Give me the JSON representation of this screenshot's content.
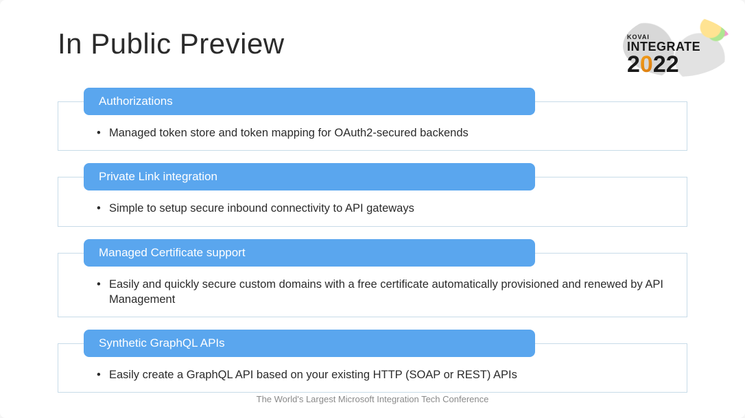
{
  "title": "In Public Preview",
  "logo": {
    "brand": "KOVAI",
    "word": "INTEGRATE",
    "year_prefix": "2",
    "year_zero": "0",
    "year_suffix": "22"
  },
  "items": [
    {
      "header": "Authorizations",
      "bullet": "Managed token store and token mapping for OAuth2-secured backends"
    },
    {
      "header": "Private Link integration",
      "bullet": "Simple to setup secure inbound connectivity to API gateways"
    },
    {
      "header": "Managed Certificate support",
      "bullet": "Easily and quickly secure custom domains with a free certificate automatically provisioned and renewed by API Management"
    },
    {
      "header": "Synthetic GraphQL APIs",
      "bullet": "Easily create a GraphQL API based on your existing HTTP (SOAP or REST) APIs"
    }
  ],
  "footer": "The World's Largest Microsoft Integration Tech Conference"
}
